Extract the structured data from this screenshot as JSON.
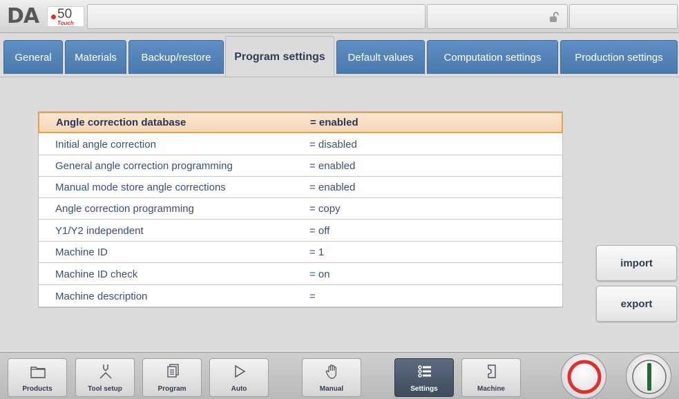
{
  "header": {
    "logo_text": "DA",
    "logo_number": "50",
    "logo_sub": "Touch",
    "lock_icon": "unlocked-padlock-icon"
  },
  "tabs": [
    {
      "label": "General",
      "active": false
    },
    {
      "label": "Materials",
      "active": false
    },
    {
      "label": "Backup/restore",
      "active": false
    },
    {
      "label": "Program settings",
      "active": true
    },
    {
      "label": "Default values",
      "active": false
    },
    {
      "label": "Computation settings",
      "active": false
    },
    {
      "label": "Production settings",
      "active": false
    }
  ],
  "settings": [
    {
      "label": "Angle correction database",
      "value": "=  enabled"
    },
    {
      "label": "Initial angle correction",
      "value": "=  disabled"
    },
    {
      "label": "General angle correction programming",
      "value": "=  enabled"
    },
    {
      "label": "Manual mode store angle corrections",
      "value": "=  enabled"
    },
    {
      "label": "Angle correction programming",
      "value": "=  copy"
    },
    {
      "label": "Y1/Y2 independent",
      "value": "=  off"
    },
    {
      "label": "Machine ID",
      "value": "=  1"
    },
    {
      "label": "Machine ID check",
      "value": "=  on"
    },
    {
      "label": "Machine description",
      "value": "="
    }
  ],
  "selected_setting_index": 0,
  "side_buttons": {
    "import_label": "import",
    "export_label": "export"
  },
  "nav": [
    {
      "label": "Products",
      "icon": "folder-icon",
      "active": false
    },
    {
      "label": "Tool setup",
      "icon": "tool-icon",
      "active": false
    },
    {
      "label": "Program",
      "icon": "program-pages-icon",
      "active": false
    },
    {
      "label": "Auto",
      "icon": "play-icon",
      "active": false
    },
    {
      "label": "Manual",
      "icon": "hand-icon",
      "active": false
    },
    {
      "label": "Settings",
      "icon": "settings-list-icon",
      "active": true
    },
    {
      "label": "Machine",
      "icon": "machine-icon",
      "active": false
    }
  ],
  "colors": {
    "tab_blue": "#4a78ad",
    "selected_row_border": "#e9a04e",
    "stop_red": "#e0302b",
    "start_green": "#1f6b3a",
    "active_nav": "#3f4b5e"
  }
}
